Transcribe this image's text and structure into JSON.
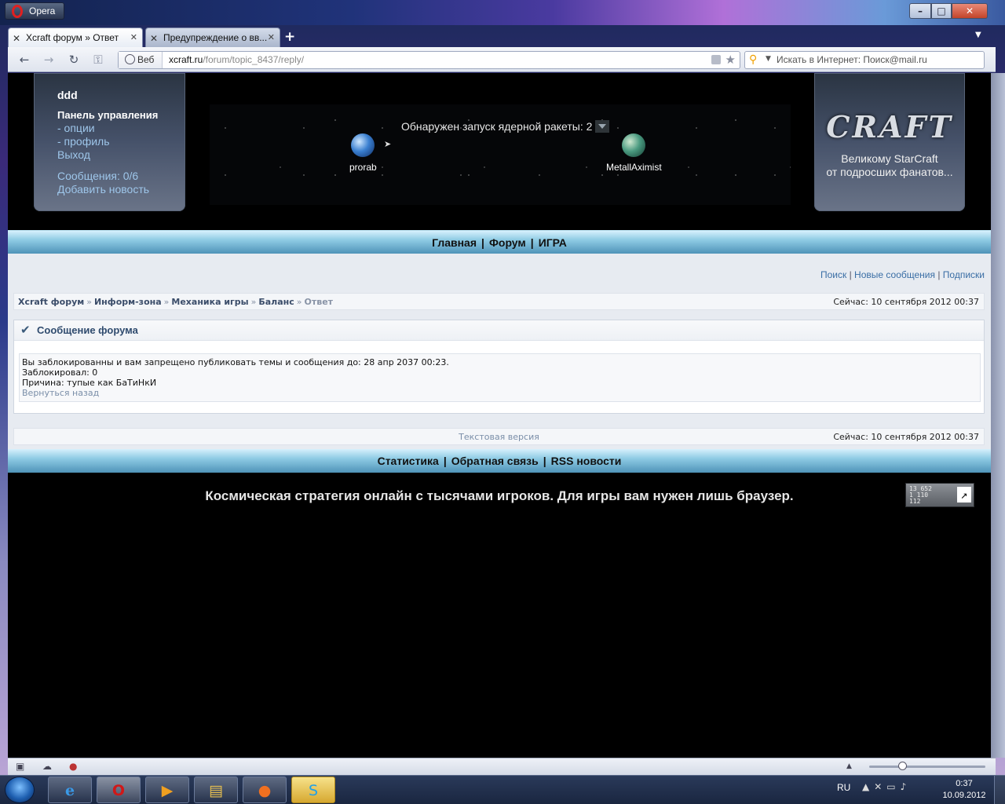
{
  "browser": {
    "menu_label": "Opera",
    "tabs": [
      {
        "label": "Xcraft форум » Ответ",
        "active": true
      },
      {
        "label": "Предупреждение о вв...",
        "active": false
      }
    ],
    "address": {
      "badge": "Веб",
      "url_host": "xcraft.ru",
      "url_path": "/forum/topic_8437/reply/"
    },
    "search": {
      "placeholder": "Искать в Интернет: Поиск@mail.ru"
    }
  },
  "site": {
    "user_panel": {
      "username": "ddd",
      "control_panel_title": "Панель управления",
      "options_link": "- опции",
      "profile_link": "- профиль",
      "logout_link": "Выход",
      "messages_link": "Сообщения: 0/6",
      "add_news_link": "Добавить новость"
    },
    "game_event": {
      "text": "Обнаружен запуск ядерной ракеты: 2",
      "attacker": "prorab",
      "target": "MetallAximist"
    },
    "brand": {
      "logo_text": "CRAFT",
      "tagline_line1": "Великому StarCraft",
      "tagline_line2": "от подросших фанатов..."
    },
    "main_nav": [
      "Главная",
      "Форум",
      "ИГРА"
    ],
    "top_links": [
      "Поиск",
      "Новые сообщения",
      "Подписки"
    ],
    "breadcrumb": [
      "Xcraft форум",
      "Информ-зона",
      "Механика игры",
      "Баланс"
    ],
    "breadcrumb_current": "Ответ",
    "server_time": "Сейчас: 10 сентября 2012 00:37",
    "message": {
      "title": "Сообщение форума",
      "line1": "Вы заблокированны и вам запрещено публиковать темы и сообщения до: 28 апр 2037 00:23.",
      "line2": "Заблокировал: 0",
      "line3": "Причина: тупые как БаТиНкИ",
      "back_link": "Вернуться назад"
    },
    "text_version": "Текстовая версия",
    "footer_nav": [
      "Статистика",
      "Обратная связь",
      "RSS новости"
    ],
    "footer_tagline": "Космическая стратегия онлайн с тысячами игроков. Для игры вам нужен лишь браузер.",
    "counter": {
      "line1": "13 652",
      "line2": "1 110",
      "line3": "112"
    }
  },
  "taskbar": {
    "language": "RU",
    "time": "0:37",
    "date": "10.09.2012"
  }
}
